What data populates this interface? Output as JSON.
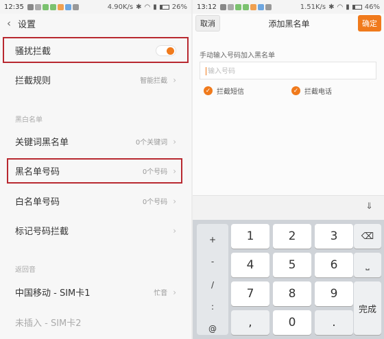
{
  "left": {
    "status": {
      "time": "12:35",
      "speed": "4.90K/s",
      "battery": "26%"
    },
    "header": {
      "back_icon": "chevron-left-icon",
      "title": "设置"
    },
    "harass_block": {
      "label": "骚扰拦截",
      "enabled": true
    },
    "rule": {
      "label": "拦截规则",
      "value": "智能拦截"
    },
    "section_blacklist": "黑白名单",
    "keyword_blacklist": {
      "label": "关键词黑名单",
      "value": "0个关键词"
    },
    "number_blacklist": {
      "label": "黑名单号码",
      "value": "0个号码"
    },
    "whitelist": {
      "label": "白名单号码",
      "value": "0个号码"
    },
    "mark_block": {
      "label": "标记号码拦截"
    },
    "section_ringback": "返回音",
    "sim1": {
      "label": "中国移动 - SIM卡1",
      "value": "忙音"
    },
    "sim2": {
      "label": "未插入 - SIM卡2"
    }
  },
  "right": {
    "status": {
      "time": "13:12",
      "speed": "1.51K/s",
      "battery": "46%"
    },
    "header": {
      "cancel": "取消",
      "title": "添加黑名单",
      "confirm": "确定"
    },
    "hint": "手动输入号码加入黑名单",
    "input_placeholder": "输入号码",
    "check_sms": "拦截短信",
    "check_call": "拦截电话",
    "keyboard": {
      "symbols": [
        "+",
        "-",
        "/",
        ":",
        "@"
      ],
      "digits": [
        "1",
        "2",
        "3",
        "4",
        "5",
        "6",
        "7",
        "8",
        "9"
      ],
      "zero": "0",
      "backspace_icon": "backspace-icon",
      "space_icon": "space-icon",
      "done": "完成",
      "hide_icon": "keyboard-hide-icon"
    }
  },
  "colors": {
    "accent": "#f07a1c",
    "highlight_border": "#b8282f"
  }
}
